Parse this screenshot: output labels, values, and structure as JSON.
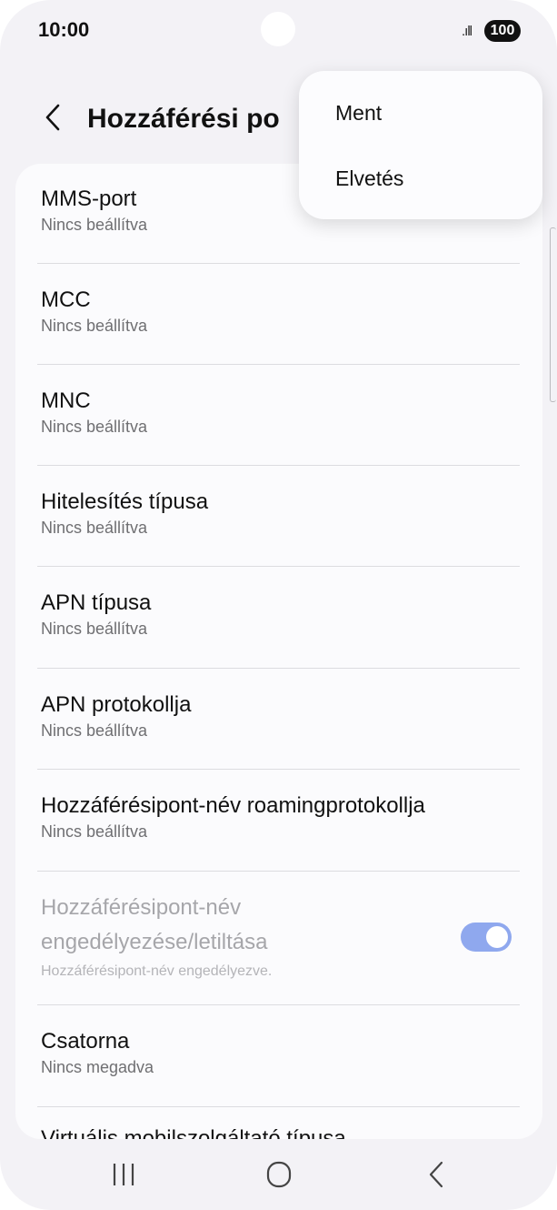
{
  "status_bar": {
    "time": "10:00",
    "signal_text": ".ıll",
    "battery": "100"
  },
  "header": {
    "back_icon": "chevron-left-icon",
    "title": "Hozzáférési po"
  },
  "settings": [
    {
      "label": "MMS-port",
      "value": "Nincs beállítva"
    },
    {
      "label": "MCC",
      "value": "Nincs beállítva"
    },
    {
      "label": "MNC",
      "value": "Nincs beállítva"
    },
    {
      "label": "Hitelesítés típusa",
      "value": "Nincs beállítva"
    },
    {
      "label": "APN típusa",
      "value": "Nincs beállítva"
    },
    {
      "label": "APN protokollja",
      "value": "Nincs beállítva"
    },
    {
      "label": "Hozzáférésipont-név roamingprotokollja",
      "value": "Nincs beállítva"
    },
    {
      "label_line1": "Hozzáférésipont-név",
      "label_line2": "engedélyezése/letiltása",
      "value": "Hozzáférésipont-név engedélyezve.",
      "toggle": "on",
      "disabled": true
    },
    {
      "label": "Csatorna",
      "value": "Nincs megadva"
    }
  ],
  "cut_off_item": "Virtuális mobilszolgáltató típusa",
  "menu": {
    "items": [
      "Ment",
      "Elvetés"
    ]
  },
  "navbar": {
    "recent": "recent-apps-icon",
    "home": "home-icon",
    "back": "back-icon"
  },
  "colors": {
    "background": "#f3f2f6",
    "card": "#fbfbfd",
    "toggle_on": "#8fa8ee"
  }
}
